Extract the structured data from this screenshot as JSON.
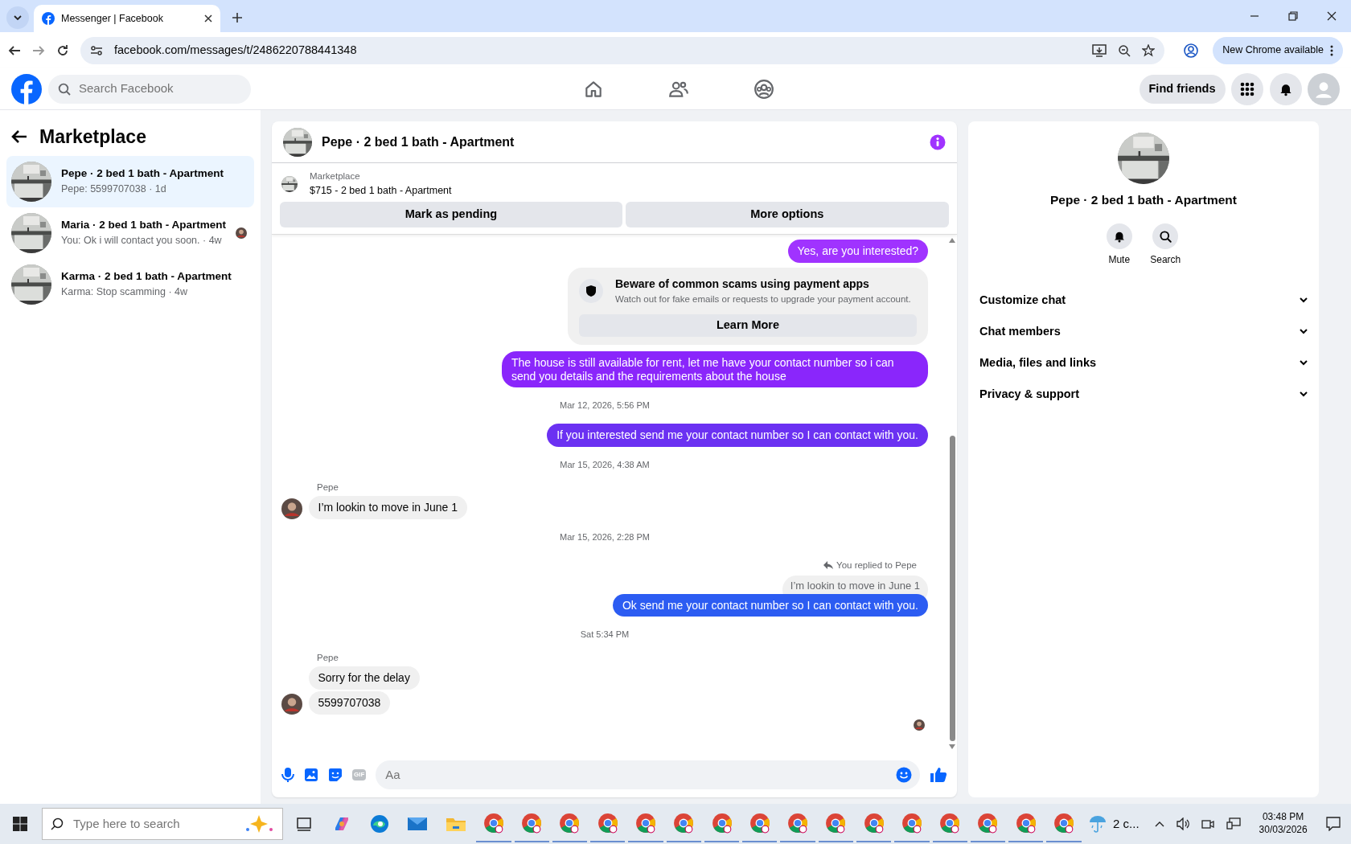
{
  "browser": {
    "tab_title": "Messenger | Facebook",
    "url": "facebook.com/messages/t/2486220788441348",
    "update_button": "New Chrome available"
  },
  "header": {
    "search_placeholder": "Search Facebook",
    "nav": [
      {
        "kind": "home",
        "selected": false
      },
      {
        "kind": "friends",
        "selected": false
      },
      {
        "kind": "groups",
        "selected": false
      }
    ],
    "find_friends": "Find friends"
  },
  "sidebar": {
    "title": "Marketplace",
    "chats": [
      {
        "title": "Pepe · 2 bed 1 bath - Apartment",
        "preview": "Pepe: 5599707038 · 1d",
        "selected": true,
        "seen": false
      },
      {
        "title": "Maria · 2 bed 1 bath - Apartment",
        "preview": "You: Ok i will contact you soon. · 4w",
        "selected": false,
        "seen": true
      },
      {
        "title": "Karma · 2 bed 1 bath - Apartment",
        "preview": "Karma: Stop scamming · 4w",
        "selected": false,
        "seen": false
      }
    ]
  },
  "chat": {
    "title": "Pepe · 2 bed 1 bath - Apartment",
    "listing": {
      "source": "Marketplace",
      "item": "$715 - 2 bed 1 bath - Apartment"
    },
    "actions": [
      "Mark as pending",
      "More options"
    ],
    "messages": [
      {
        "kind": "sent",
        "text": "Yes, are you interested?",
        "color": "#a033ff"
      },
      {
        "kind": "notice",
        "title": "Beware of common scams using payment apps",
        "text": "Watch out for fake emails or requests to upgrade your payment account.",
        "button": "Learn More"
      },
      {
        "kind": "sent",
        "text": "The house is still available for rent, let me have your contact number so i can send you details and the requirements about the house",
        "color": "#8a26fb"
      },
      {
        "kind": "time",
        "text": "Mar 12, 2026, 5:56 PM"
      },
      {
        "kind": "sent",
        "text": "If you interested send me your contact number so I can contact with you.",
        "color": "#6b31f2"
      },
      {
        "kind": "time",
        "text": "Mar 15, 2026, 4:38 AM"
      },
      {
        "kind": "received",
        "sender": "Pepe",
        "texts": [
          "I’m lookin to move in June 1"
        ]
      },
      {
        "kind": "time",
        "text": "Mar 15, 2026, 2:28 PM"
      },
      {
        "kind": "reply",
        "note": "You replied to Pepe",
        "quote": "I’m lookin to move in June 1",
        "text": "Ok send me your contact number so I can contact with you.",
        "color": "#2c5cf2"
      },
      {
        "kind": "time",
        "text": "Sat 5:34 PM"
      },
      {
        "kind": "received",
        "sender": "Pepe",
        "texts": [
          "Sorry for the delay",
          "5599707038"
        ]
      }
    ],
    "seen": true,
    "composer": {
      "placeholder": "Aa",
      "gif": "GIF"
    }
  },
  "details": {
    "title": "Pepe · 2 bed 1 bath - Apartment",
    "actions": [
      {
        "kind": "bell",
        "label": "Mute"
      },
      {
        "kind": "search",
        "label": "Search"
      }
    ],
    "sections": [
      {
        "label": "Customize chat",
        "expanded": false
      },
      {
        "label": "Chat members",
        "expanded": false
      },
      {
        "label": "Media, files and links",
        "expanded": false
      },
      {
        "label": "Privacy & support",
        "expanded": false
      }
    ]
  },
  "taskbar": {
    "search_placeholder": "Type here to search",
    "apps": [
      {
        "kind": "taskview"
      },
      {
        "kind": "copilot"
      },
      {
        "kind": "edge"
      },
      {
        "kind": "mail"
      },
      {
        "kind": "folder"
      },
      {
        "kind": "chrome"
      },
      {
        "kind": "chrome"
      },
      {
        "kind": "chrome"
      },
      {
        "kind": "chrome"
      },
      {
        "kind": "chrome"
      },
      {
        "kind": "chrome"
      },
      {
        "kind": "chrome"
      },
      {
        "kind": "chrome"
      },
      {
        "kind": "chrome"
      },
      {
        "kind": "chrome"
      },
      {
        "kind": "chrome"
      },
      {
        "kind": "chrome"
      },
      {
        "kind": "chrome"
      },
      {
        "kind": "chrome"
      },
      {
        "kind": "chrome"
      },
      {
        "kind": "chrome"
      }
    ],
    "weather": "2 c...",
    "time": "03:48 PM",
    "date": "30/03/2026"
  }
}
